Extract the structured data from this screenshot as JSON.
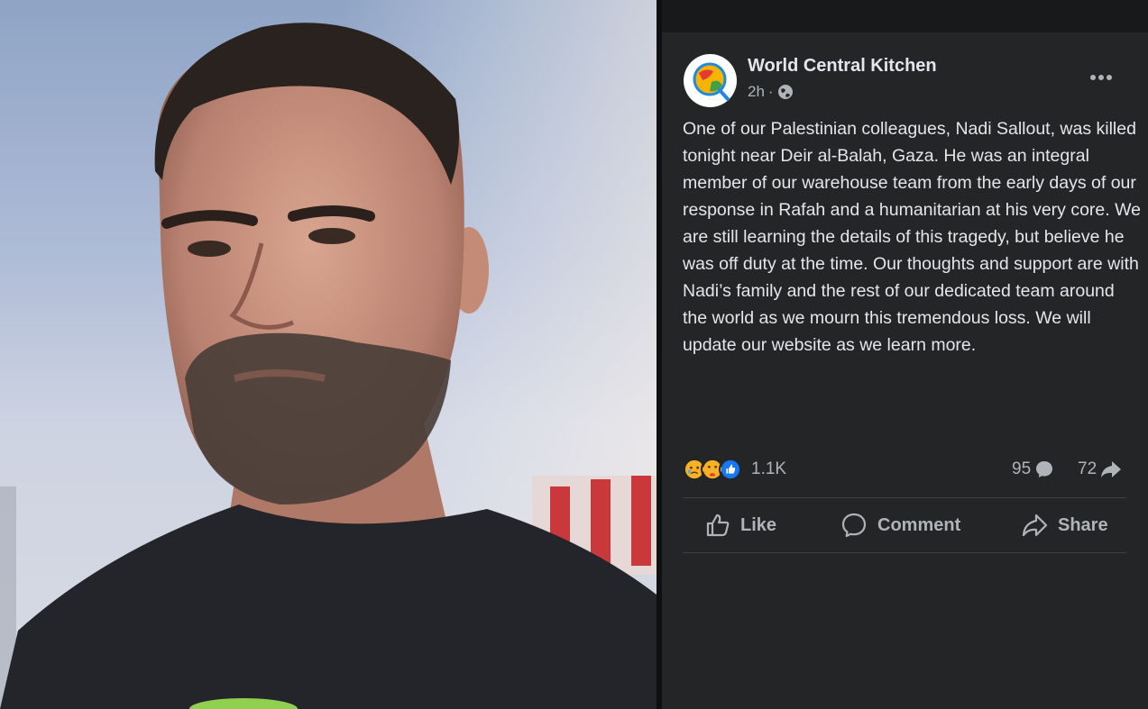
{
  "photo": {
    "icon": "person-portrait-photo"
  },
  "post": {
    "page_name": "World Central Kitchen",
    "time": "2h",
    "separator": "·",
    "privacy_icon": "globe-icon",
    "more_icon": "more-options-icon",
    "text": "One of our Palestinian colleagues, Nadi Sallout, was killed tonight near Deir al-Balah, Gaza. He was an integral member of our warehouse team from the early days of our response in Rafah and a humanitarian at his very core. We are still learning the details of this tragedy, but believe he was off duty at the time. Our thoughts and support are with Nadi’s family and the rest of our dedicated team around the world as we mourn this tremendous loss. We will update our website as we learn more."
  },
  "stats": {
    "reactions": [
      "sad",
      "care",
      "like"
    ],
    "reaction_count": "1.1K",
    "comment_count": "95",
    "share_count": "72"
  },
  "actions": {
    "like_label": "Like",
    "comment_label": "Comment",
    "share_label": "Share"
  },
  "colors": {
    "background": "#242526",
    "text_primary": "#e4e6eb",
    "text_secondary": "#b0b3b8",
    "like_blue": "#1877f2"
  }
}
